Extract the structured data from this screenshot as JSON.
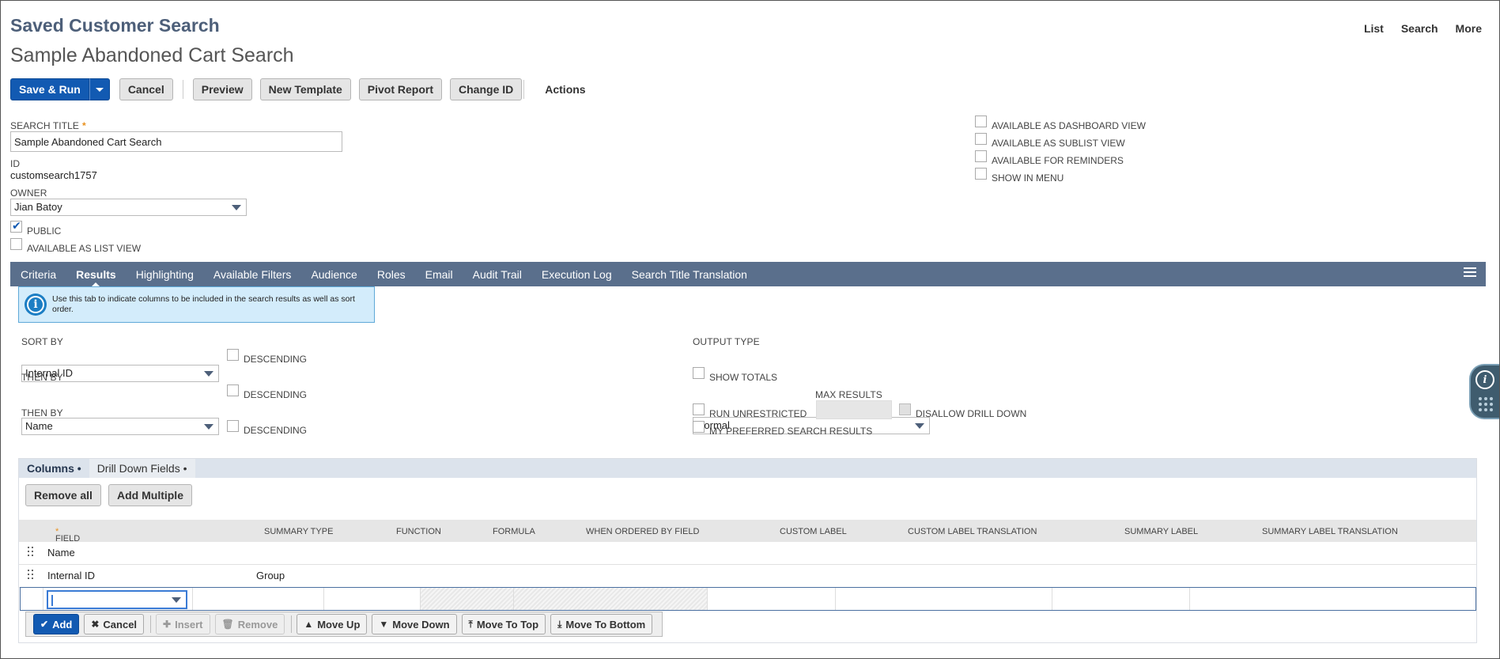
{
  "header": {
    "title": "Saved Customer Search",
    "subtitle": "Sample Abandoned Cart Search"
  },
  "top_links": [
    "List",
    "Search",
    "More"
  ],
  "toolbar": {
    "save_run": "Save & Run",
    "cancel": "Cancel",
    "preview": "Preview",
    "new_template": "New Template",
    "pivot_report": "Pivot Report",
    "change_id": "Change ID",
    "actions": "Actions"
  },
  "form": {
    "search_title_label": "SEARCH TITLE",
    "required_mark": "*",
    "search_title_value": "Sample Abandoned Cart Search",
    "id_label": "ID",
    "id_value": "customsearch1757",
    "owner_label": "OWNER",
    "owner_value": "Jian Batoy",
    "public_label": "PUBLIC",
    "available_list_view_label": "AVAILABLE AS LIST VIEW",
    "right_options": [
      "AVAILABLE AS DASHBOARD VIEW",
      "AVAILABLE AS SUBLIST VIEW",
      "AVAILABLE FOR REMINDERS",
      "SHOW IN MENU"
    ]
  },
  "tabs": [
    "Criteria",
    "Results",
    "Highlighting",
    "Available Filters",
    "Audience",
    "Roles",
    "Email",
    "Audit Trail",
    "Execution Log",
    "Search Title Translation"
  ],
  "info_text": "Use this tab to indicate columns to be included in the search results as well as sort order.",
  "sort": {
    "sort_by_label": "SORT BY",
    "sort_by_value": "Internal ID",
    "then_by_label": "THEN BY",
    "then_by_1_value": "Name",
    "then_by_2_value": "",
    "descending_label": "DESCENDING"
  },
  "output": {
    "output_type_label": "OUTPUT TYPE",
    "output_type_value": "Normal",
    "show_totals_label": "SHOW TOTALS",
    "max_results_label": "MAX RESULTS",
    "run_unrestricted_label": "RUN UNRESTRICTED",
    "disallow_drill_down_label": "DISALLOW DRILL DOWN",
    "preferred_label": "MY PREFERRED SEARCH RESULTS"
  },
  "subtabs": [
    "Columns •",
    "Drill Down Fields •"
  ],
  "columns_buttons": {
    "remove_all": "Remove all",
    "add_multiple": "Add Multiple"
  },
  "grid": {
    "headers": [
      "FIELD",
      "SUMMARY TYPE",
      "FUNCTION",
      "FORMULA",
      "WHEN ORDERED BY FIELD",
      "CUSTOM LABEL",
      "CUSTOM LABEL TRANSLATION",
      "SUMMARY LABEL",
      "SUMMARY LABEL TRANSLATION"
    ],
    "rows": [
      {
        "field": "Name",
        "summary_type": ""
      },
      {
        "field": "Internal ID",
        "summary_type": "Group"
      }
    ]
  },
  "machine_buttons": {
    "add": "Add",
    "cancel": "Cancel",
    "insert": "Insert",
    "remove": "Remove",
    "move_up": "Move Up",
    "move_down": "Move Down",
    "move_to_top": "Move To Top",
    "move_to_bottom": "Move To Bottom"
  },
  "colors": {
    "primary": "#125ab2",
    "tabbar": "#5a6f8c",
    "header_text": "#4d5f79",
    "required": "#e8901c"
  }
}
